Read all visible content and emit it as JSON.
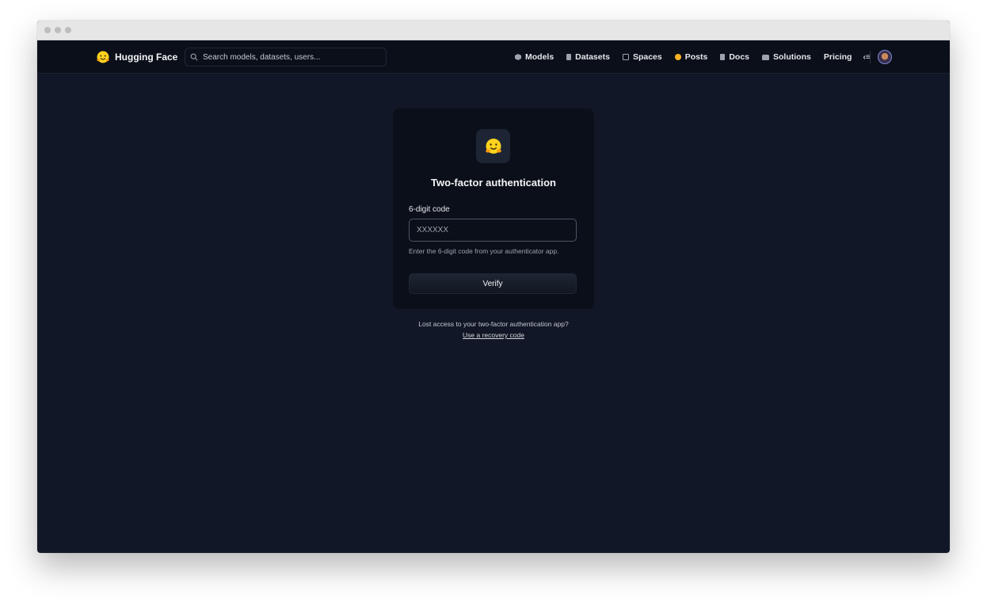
{
  "navbar": {
    "brand": "Hugging Face",
    "search_placeholder": "Search models, datasets, users...",
    "links": [
      {
        "label": "Models",
        "icon": "cube-icon"
      },
      {
        "label": "Datasets",
        "icon": "database-icon"
      },
      {
        "label": "Spaces",
        "icon": "grid-icon"
      },
      {
        "label": "Posts",
        "icon": "chat-bubble-icon"
      },
      {
        "label": "Docs",
        "icon": "document-icon"
      },
      {
        "label": "Solutions",
        "icon": "briefcase-icon"
      },
      {
        "label": "Pricing"
      }
    ],
    "more_menu": "‹≡"
  },
  "card": {
    "title": "Two-factor authentication",
    "field_label": "6-digit code",
    "code_placeholder": "XXXXXX",
    "helper": "Enter the 6-digit code from your authenticator app.",
    "verify_label": "Verify"
  },
  "footer": {
    "lost_access": "Lost access to your two-factor authentication app?",
    "recovery_link": "Use a recovery code"
  },
  "colors": {
    "background": "#111726",
    "navbar": "#0b0f19",
    "card": "#0b0f19",
    "accent_yellow": "#f5b324"
  }
}
